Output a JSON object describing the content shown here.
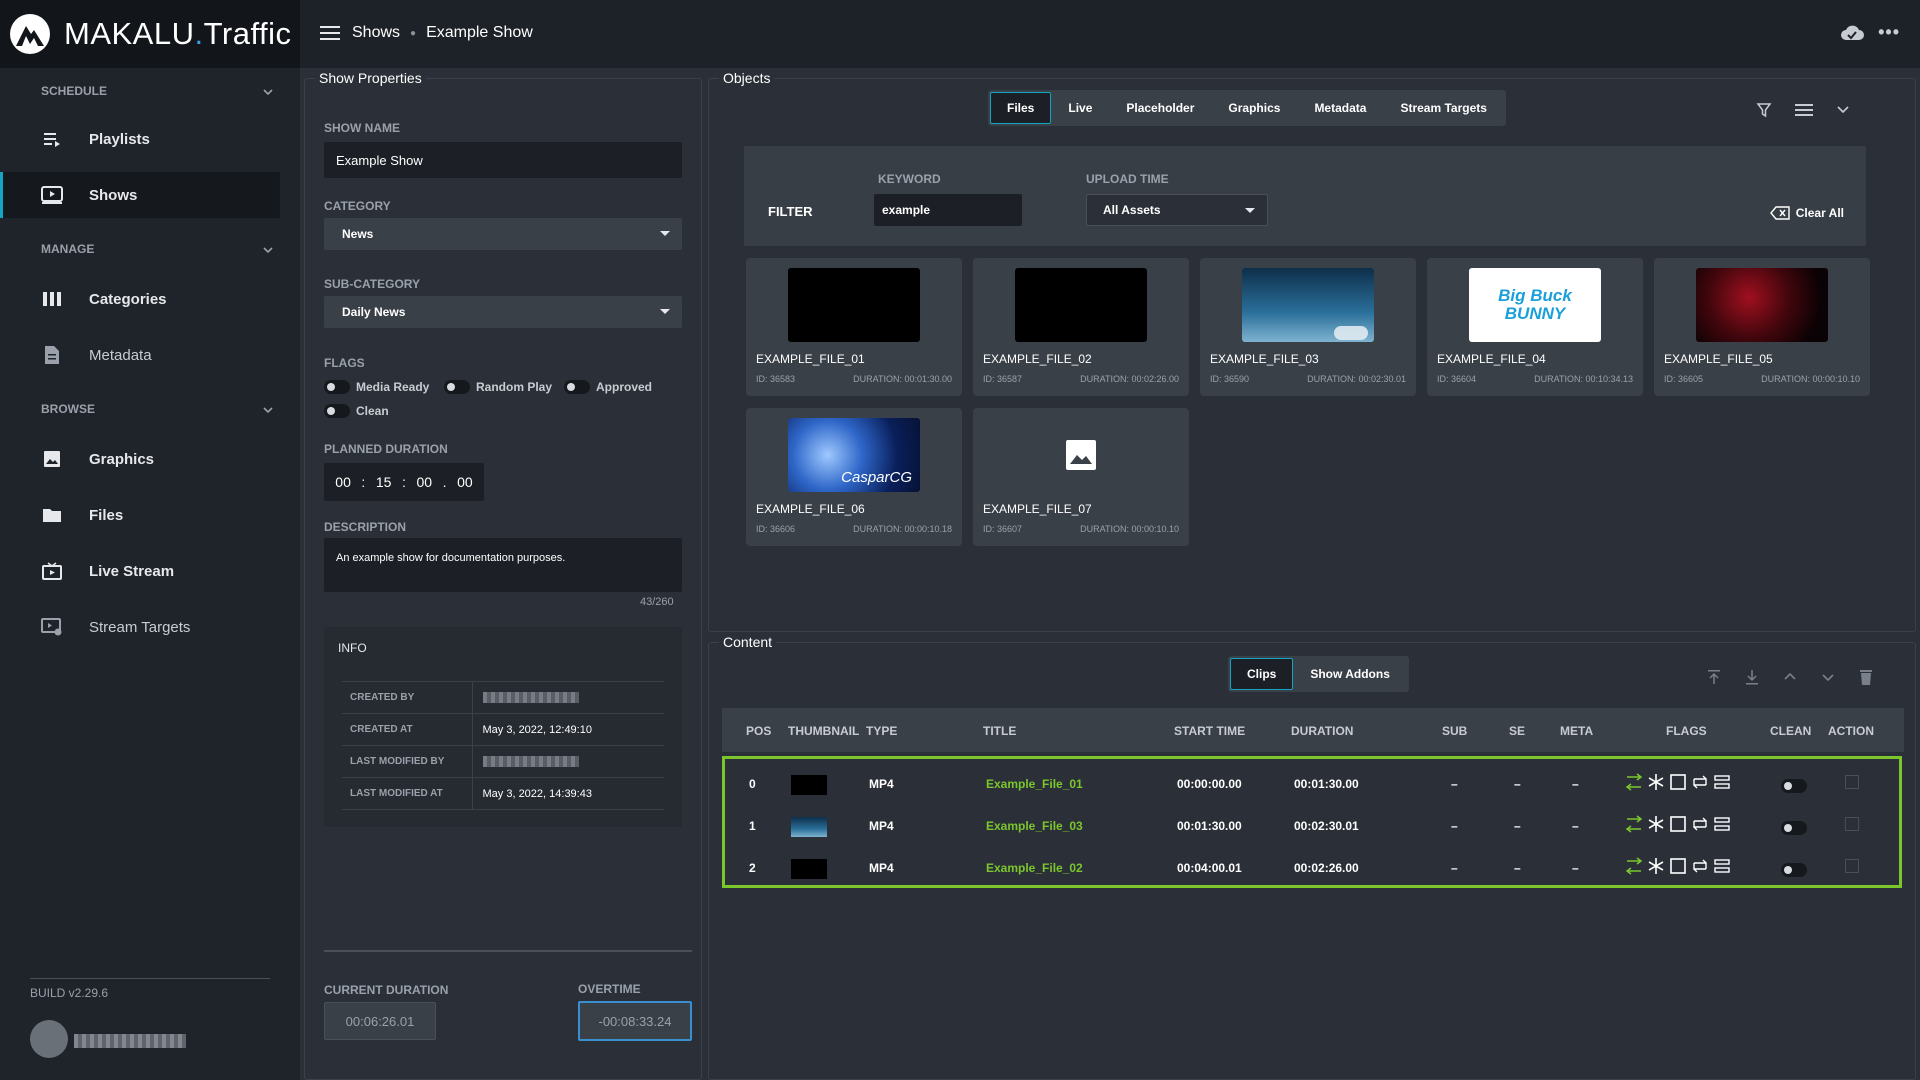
{
  "app": {
    "brand_main": "MAKALU",
    "brand_dot": ".",
    "brand_sub": "Traffic"
  },
  "breadcrumb": {
    "section": "Shows",
    "page": "Example Show"
  },
  "sidebar": {
    "sections": {
      "schedule": "SCHEDULE",
      "manage": "MANAGE",
      "browse": "BROWSE"
    },
    "items": {
      "playlists": "Playlists",
      "shows": "Shows",
      "categories": "Categories",
      "metadata": "Metadata",
      "graphics": "Graphics",
      "files": "Files",
      "live_stream": "Live Stream",
      "stream_targets": "Stream Targets"
    },
    "build": "BUILD v2.29.6"
  },
  "show_properties": {
    "title": "Show Properties",
    "show_name_label": "SHOW NAME",
    "show_name": "Example Show",
    "category_label": "CATEGORY",
    "category": "News",
    "subcategory_label": "SUB-CATEGORY",
    "subcategory": "Daily News",
    "flags_label": "FLAGS",
    "flags": {
      "media_ready": "Media Ready",
      "random_play": "Random Play",
      "approved": "Approved",
      "clean": "Clean"
    },
    "planned_label": "PLANNED DURATION",
    "planned": {
      "hh": "00",
      "mm": "15",
      "ss": "00",
      "ff": "00",
      "sep1": ":",
      "sep2": ":",
      "sep3": "."
    },
    "description_label": "DESCRIPTION",
    "description": "An example show for documentation purposes.",
    "description_count": "43/260",
    "info": {
      "title": "INFO",
      "created_by_label": "CREATED BY",
      "created_at_label": "CREATED AT",
      "created_at": "May 3, 2022, 12:49:10",
      "modified_by_label": "LAST MODIFIED BY",
      "modified_at_label": "LAST MODIFIED AT",
      "modified_at": "May 3, 2022, 14:39:43"
    },
    "current_duration_label": "CURRENT DURATION",
    "current_duration": "00:06:26.01",
    "overtime_label": "OVERTIME",
    "overtime": "-00:08:33.24"
  },
  "objects": {
    "title": "Objects",
    "tabs": {
      "files": "Files",
      "live": "Live",
      "placeholder": "Placeholder",
      "graphics": "Graphics",
      "metadata": "Metadata",
      "stream_targets": "Stream Targets"
    },
    "filter": {
      "label": "FILTER",
      "keyword_label": "KEYWORD",
      "keyword": "example",
      "upload_label": "UPLOAD TIME",
      "upload_value": "All Assets",
      "clear_all": "Clear All"
    },
    "files": [
      {
        "name": "EXAMPLE_FILE_01",
        "id": "ID: 36583",
        "duration": "DURATION: 00:01:30.00"
      },
      {
        "name": "EXAMPLE_FILE_02",
        "id": "ID: 36587",
        "duration": "DURATION: 00:02:26.00"
      },
      {
        "name": "EXAMPLE_FILE_03",
        "id": "ID: 36590",
        "duration": "DURATION: 00:02:30.01"
      },
      {
        "name": "EXAMPLE_FILE_04",
        "id": "ID: 36604",
        "duration": "DURATION: 00:10:34.13",
        "thumb_text": "Big Buck BUNNY"
      },
      {
        "name": "EXAMPLE_FILE_05",
        "id": "ID: 36605",
        "duration": "DURATION: 00:00:10.10"
      },
      {
        "name": "EXAMPLE_FILE_06",
        "id": "ID: 36606",
        "duration": "DURATION: 00:00:10.18",
        "thumb_text": "CasparCG"
      },
      {
        "name": "EXAMPLE_FILE_07",
        "id": "ID: 36607",
        "duration": "DURATION: 00:00:10.10"
      }
    ]
  },
  "content": {
    "title": "Content",
    "tabs": {
      "clips": "Clips",
      "addons": "Show Addons"
    },
    "headers": {
      "pos": "POS",
      "thumbnail": "THUMBNAIL",
      "type": "TYPE",
      "title": "TITLE",
      "start": "START TIME",
      "duration": "DURATION",
      "sub": "SUB",
      "se": "SE",
      "meta": "META",
      "flags": "FLAGS",
      "clean": "CLEAN",
      "action": "ACTION"
    },
    "rows": [
      {
        "pos": "0",
        "type": "MP4",
        "title": "Example_File_01",
        "start": "00:00:00.00",
        "duration": "00:01:30.00",
        "sub": "–",
        "se": "–",
        "meta": "–"
      },
      {
        "pos": "1",
        "type": "MP4",
        "title": "Example_File_03",
        "start": "00:01:30.00",
        "duration": "00:02:30.01",
        "sub": "–",
        "se": "–",
        "meta": "–"
      },
      {
        "pos": "2",
        "type": "MP4",
        "title": "Example_File_02",
        "start": "00:04:00.01",
        "duration": "00:02:26.00",
        "sub": "–",
        "se": "–",
        "meta": "–"
      }
    ]
  },
  "colors": {
    "accent": "#16a4c4",
    "highlight": "#7bc62d",
    "overtime_border": "#3a8fd0"
  }
}
